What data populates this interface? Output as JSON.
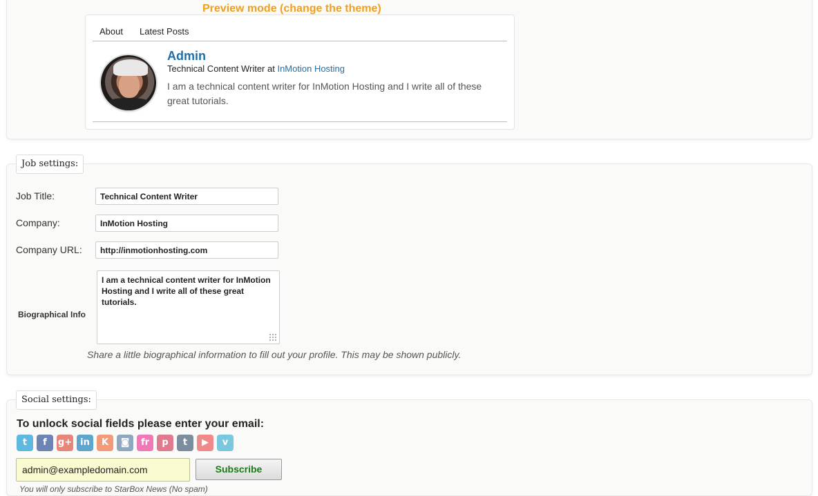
{
  "preview": {
    "title": "Preview mode (change the theme)",
    "tabs": [
      "About",
      "Latest Posts"
    ],
    "name": "Admin",
    "job_prefix": "Technical Content Writer at",
    "company_link": "InMotion Hosting",
    "bio": "I am a technical content writer for InMotion Hosting and I write all of these great tutorials."
  },
  "job_settings": {
    "legend": "Job settings:",
    "job_title_label": "Job Title:",
    "job_title_value": "Technical Content Writer",
    "company_label": "Company:",
    "company_value": "InMotion Hosting",
    "company_url_label": "Company URL:",
    "company_url_value": "http://inmotionhosting.com",
    "bio_label": "Biographical Info",
    "bio_value": "I am a technical content writer for InMotion Hosting and I write all of these great tutorials.",
    "bio_hint": "Share a little biographical information to fill out your profile. This may be shown publicly."
  },
  "social_settings": {
    "legend": "Social settings:",
    "unlock_text": "To unlock social fields please enter your email:",
    "icons": [
      {
        "name": "twitter-icon",
        "glyph": "t",
        "color": "#5fb8e0"
      },
      {
        "name": "facebook-icon",
        "glyph": "f",
        "color": "#6d85b5"
      },
      {
        "name": "google-plus-icon",
        "glyph": "g+",
        "color": "#e8867a"
      },
      {
        "name": "linkedin-icon",
        "glyph": "in",
        "color": "#5fa6cf"
      },
      {
        "name": "klout-icon",
        "glyph": "K",
        "color": "#f29a7a"
      },
      {
        "name": "instagram-icon",
        "glyph": "◙",
        "color": "#8ea8c0"
      },
      {
        "name": "flickr-icon",
        "glyph": "fr",
        "color": "#f07ab8"
      },
      {
        "name": "pinterest-icon",
        "glyph": "p",
        "color": "#e07a8e"
      },
      {
        "name": "tumblr-icon",
        "glyph": "t",
        "color": "#7a8ea0"
      },
      {
        "name": "youtube-icon",
        "glyph": "▶",
        "color": "#f08a8a"
      },
      {
        "name": "vimeo-icon",
        "glyph": "v",
        "color": "#7ac8e0"
      }
    ],
    "email_value": "admin@exampledomain.com",
    "subscribe_label": "Subscribe",
    "note": "You will only subscribe to StarBox News (No spam)"
  }
}
